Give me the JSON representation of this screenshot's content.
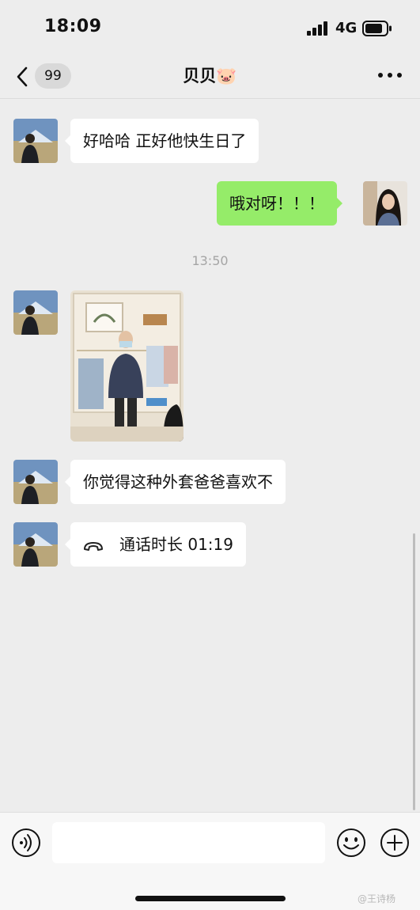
{
  "status_bar": {
    "time": "18:09",
    "network": "4G",
    "icons": [
      "signal-bars-icon",
      "battery-icon"
    ]
  },
  "header": {
    "back_icon": "chevron-left-icon",
    "unread_count": "99",
    "title": "贝贝🐷",
    "more_icon": "more-dots-icon"
  },
  "messages": [
    {
      "direction": "incoming",
      "type": "text",
      "text": "好哈哈 正好他快生日了"
    },
    {
      "direction": "outgoing",
      "type": "text",
      "text": "哦对呀！！！"
    },
    {
      "type": "timestamp",
      "text": "13:50"
    },
    {
      "direction": "incoming",
      "type": "image",
      "image": "photo of a man in a dark jacket in a clothing store"
    },
    {
      "direction": "incoming",
      "type": "text",
      "text": "你觉得这种外套爸爸喜欢不"
    },
    {
      "direction": "incoming",
      "type": "call",
      "icon": "phone-call-icon",
      "text": "通话时长 01:19"
    }
  ],
  "input_bar": {
    "voice_icon": "voice-input-icon",
    "input_value": "",
    "emoji_icon": "emoji-icon",
    "plus_icon": "plus-icon"
  },
  "watermark": "@王诗杨",
  "colors": {
    "background": "#ededed",
    "incoming_bubble": "#ffffff",
    "outgoing_bubble": "#95ec69",
    "timestamp_text": "#a5a5a5",
    "input_bar": "#f7f7f7"
  }
}
